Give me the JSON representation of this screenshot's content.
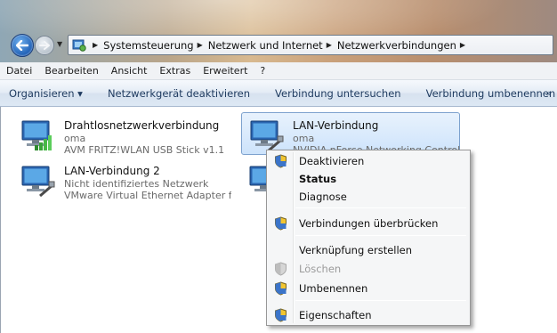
{
  "address": {
    "breadcrumbs": [
      "Systemsteuerung",
      "Netzwerk und Internet",
      "Netzwerkverbindungen"
    ]
  },
  "menubar": {
    "items": [
      "Datei",
      "Bearbeiten",
      "Ansicht",
      "Extras",
      "Erweitert",
      "?"
    ]
  },
  "commandbar": {
    "organize": "Organisieren ▾",
    "commands": [
      "Netzwerkgerät deaktivieren",
      "Verbindung untersuchen",
      "Verbindung umbenennen"
    ],
    "more": "»"
  },
  "connections": [
    {
      "name": "Drahtlosnetzwerkverbindung",
      "status": "oma",
      "device": "AVM FRITZ!WLAN USB Stick v1.1"
    },
    {
      "name": "LAN-Verbindung",
      "status": "oma",
      "device": "NVIDIA nForce Networking Controller"
    },
    {
      "name": "LAN-Verbindung 2",
      "status": "Nicht identifiziertes Netzwerk",
      "device": "VMware Virtual Ethernet Adapter f..."
    },
    {
      "name": "",
      "status": "",
      "device": ""
    }
  ],
  "context_menu": {
    "items": [
      {
        "label": "Deaktivieren",
        "icon": "shield-icon"
      },
      {
        "label": "Status",
        "bold": true
      },
      {
        "label": "Diagnose"
      },
      {
        "label": "Verbindungen überbrücken",
        "icon": "shield-icon"
      },
      {
        "label": "Verknüpfung erstellen"
      },
      {
        "label": "Löschen",
        "icon": "shield-icon",
        "disabled": true
      },
      {
        "label": "Umbenennen",
        "icon": "shield-icon"
      },
      {
        "label": "Eigenschaften",
        "icon": "shield-icon"
      }
    ]
  },
  "colors": {
    "selection": "#cde3fb",
    "command_text": "#1e3a5f"
  }
}
